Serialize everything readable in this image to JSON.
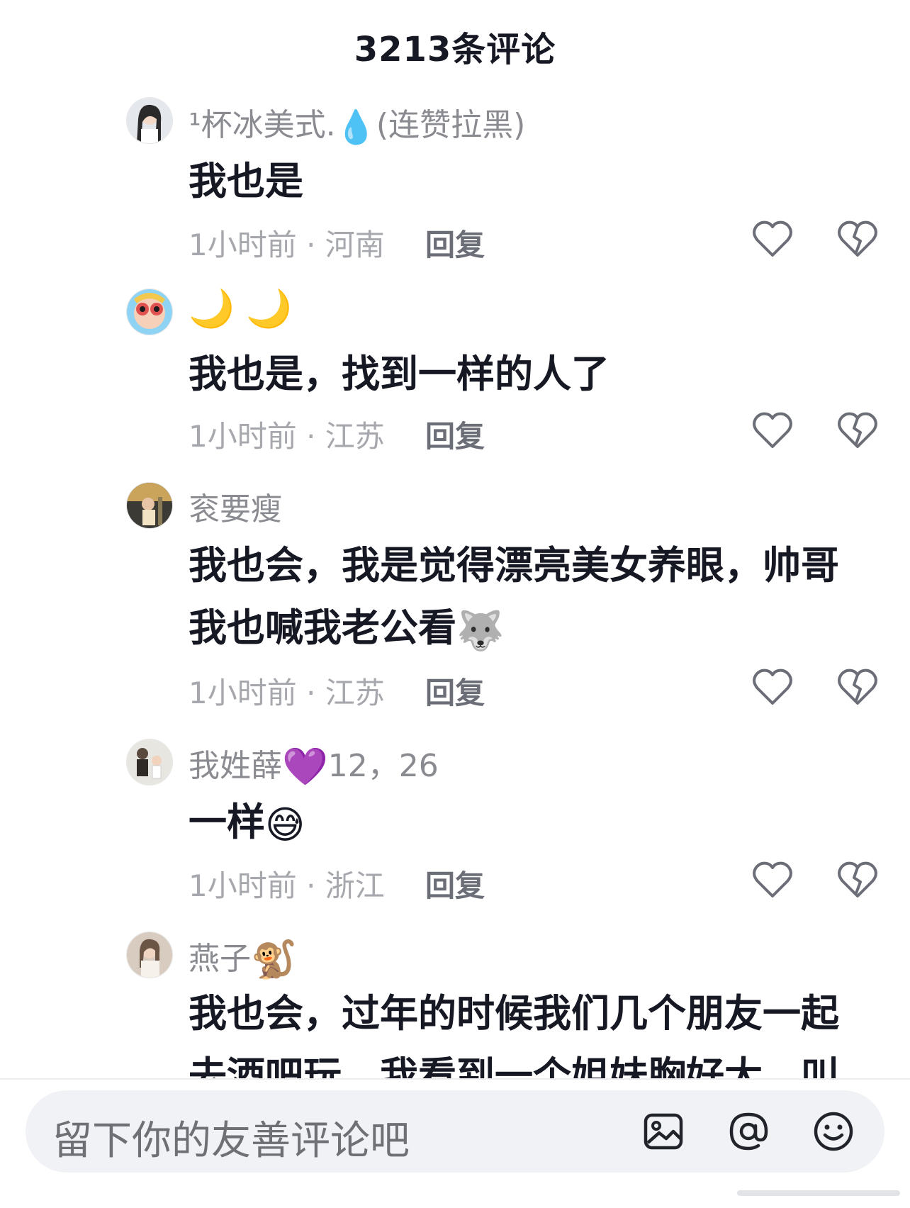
{
  "header": {
    "title": "3213条评论"
  },
  "comments": [
    {
      "username": "¹杯冰美式.",
      "username_emoji": "💧",
      "username_suffix": "(连赞拉黑)",
      "text": "我也是",
      "time_loc": "1小时前 · 河南",
      "reply": "回复",
      "avatar_colors": [
        "#d9dde3",
        "#2a2a2a"
      ]
    },
    {
      "username": "",
      "username_emoji": "🌙 🌙",
      "username_suffix": "",
      "text": "我也是，找到一样的人了",
      "time_loc": "1小时前 · 江苏",
      "reply": "回复",
      "avatar_colors": [
        "#f2c94c",
        "#e0524f"
      ]
    },
    {
      "username": "衮要瘦",
      "username_emoji": "",
      "username_suffix": "",
      "text": "我也会，我是觉得漂亮美女养眼，帅哥我也喊我老公看",
      "text_emoji": "🐺",
      "time_loc": "1小时前 · 江苏",
      "reply": "回复",
      "avatar_colors": [
        "#c9a45a",
        "#3c3a35"
      ]
    },
    {
      "username": "我姓薛",
      "username_emoji": "💜",
      "username_suffix": "12，26",
      "text": "一样",
      "text_emoji": "😅",
      "time_loc": "1小时前 · 浙江",
      "reply": "回复",
      "avatar_colors": [
        "#e8e6e1",
        "#5a4a3e"
      ]
    },
    {
      "username": "燕子",
      "username_emoji": "🐒",
      "username_suffix": "",
      "text": "我也会，过年的时候我们几个朋友一起去酒吧玩，我看到一个姐妹胸好大，叫",
      "avatar_colors": [
        "#d8cbbf",
        "#6b5545"
      ]
    }
  ],
  "input": {
    "placeholder": "留下你的友善评论吧"
  },
  "icons": [
    "image-icon",
    "at-icon",
    "emoji-icon",
    "heart-icon",
    "broken-heart-icon"
  ]
}
